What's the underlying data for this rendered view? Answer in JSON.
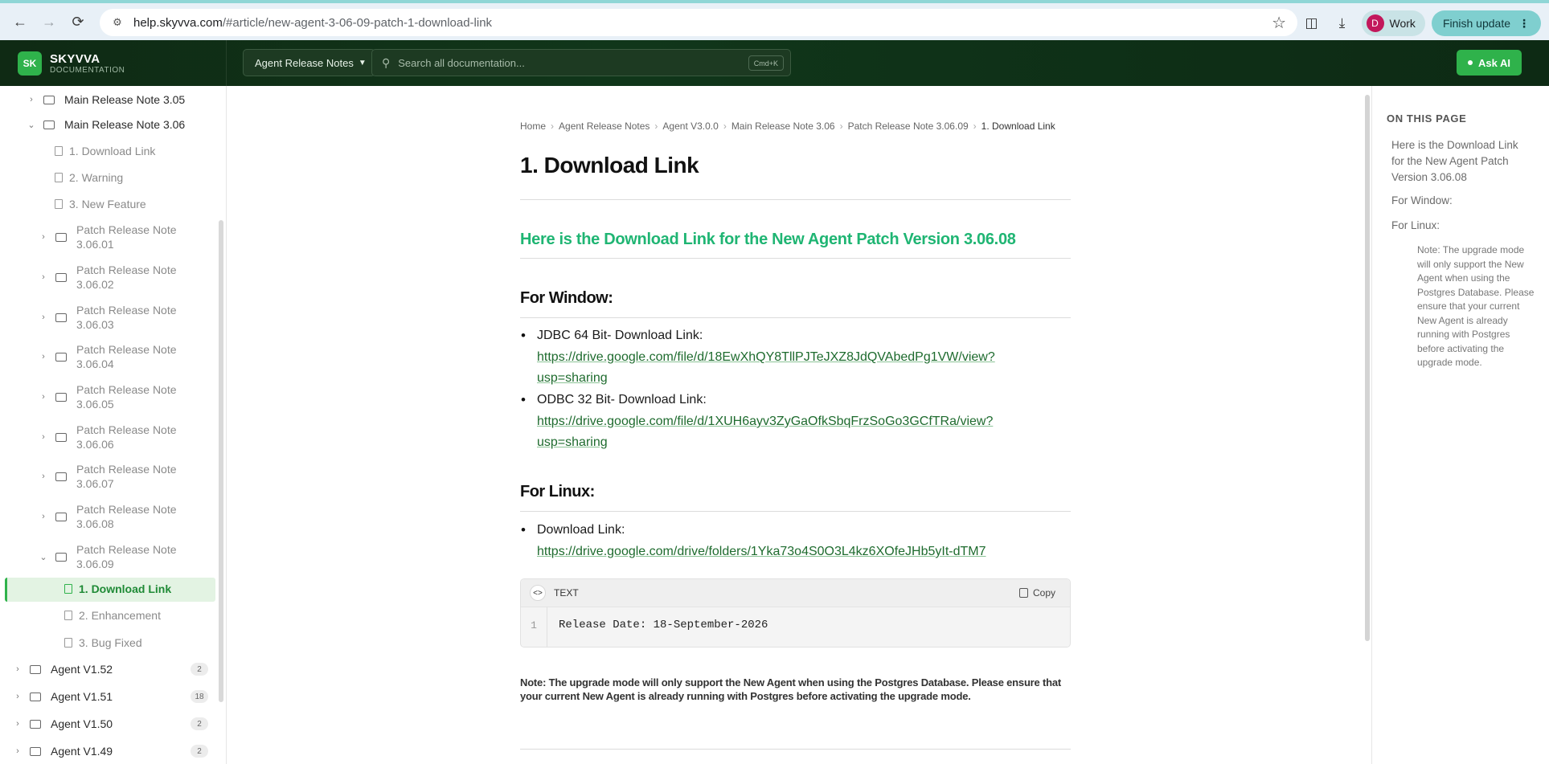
{
  "browser": {
    "url_host": "help.skyvva.com",
    "url_path": "/#article/new-agent-3-06-09-patch-1-download-link",
    "profile_initial": "D",
    "profile_label": "Work",
    "update_label": "Finish update"
  },
  "header": {
    "logo_text": "SK",
    "brand_name": "SKYVVA",
    "brand_sub": "DOCUMENTATION",
    "selector_label": "Agent Release Notes",
    "search_placeholder": "Search all documentation...",
    "search_shortcut": "Cmd+K",
    "ask_ai_label": "Ask AI"
  },
  "sidebar": {
    "items": [
      {
        "label": "Main Release Note 3.05"
      },
      {
        "label": "Main Release Note 3.06"
      },
      {
        "label": "1. Download Link"
      },
      {
        "label": "2. Warning"
      },
      {
        "label": "3. New Feature"
      },
      {
        "label": "Patch Release Note",
        "label2": "3.06.01"
      },
      {
        "label": "Patch Release Note",
        "label2": "3.06.02"
      },
      {
        "label": "Patch Release Note",
        "label2": "3.06.03"
      },
      {
        "label": "Patch Release Note",
        "label2": "3.06.04"
      },
      {
        "label": "Patch Release Note",
        "label2": "3.06.05"
      },
      {
        "label": "Patch Release Note",
        "label2": "3.06.06"
      },
      {
        "label": "Patch Release Note",
        "label2": "3.06.07"
      },
      {
        "label": "Patch Release Note",
        "label2": "3.06.08"
      },
      {
        "label": "Patch Release Note",
        "label2": "3.06.09"
      },
      {
        "label": "1. Download Link"
      },
      {
        "label": "2. Enhancement"
      },
      {
        "label": "3. Bug Fixed"
      },
      {
        "label": "Agent V1.52",
        "count": "2"
      },
      {
        "label": "Agent V1.51",
        "count": "18"
      },
      {
        "label": "Agent V1.50",
        "count": "2"
      },
      {
        "label": "Agent V1.49",
        "count": "2"
      }
    ]
  },
  "breadcrumb": {
    "items": [
      "Home",
      "Agent Release Notes",
      "Agent V3.0.0",
      "Main Release Note 3.06",
      "Patch Release Note 3.06.09"
    ],
    "current": "1. Download Link"
  },
  "article": {
    "title": "1. Download Link",
    "heading": "Here is the Download Link for the New Agent Patch Version 3.06.08",
    "window_heading": "For Window:",
    "jdbc_label": "JDBC 64 Bit- Download Link:",
    "jdbc_link_1": "https://drive.google.com/file/d/18EwXhQY8TllPJTeJXZ8JdQVAbedPg1VW/view?",
    "jdbc_link_2": "usp=sharing",
    "odbc_label": "ODBC 32 Bit- Download Link:",
    "odbc_link_1": "https://drive.google.com/file/d/1XUH6ayv3ZyGaOfkSbqFrzSoGo3GCfTRa/view?",
    "odbc_link_2": "usp=sharing",
    "linux_heading": "For Linux:",
    "linux_label": "Download Link:",
    "linux_link": "https://drive.google.com/drive/folders/1Yka73o4S0O3L4kz6XOfeJHb5yIt-dTM7",
    "code_lang": "TEXT",
    "copy_label": "Copy",
    "code_line_no": "1",
    "code_line": "Release Date: 18-September-2026",
    "note": "Note: The upgrade mode will only support the New Agent when using the Postgres Database. Please ensure that your current New Agent is already running with Postgres before activating the upgrade mode."
  },
  "toc": {
    "title": "ON THIS PAGE",
    "item1": "Here is the Download Link for the New Agent Patch Version 3.06.08",
    "item2": "For Window:",
    "item3": "For Linux:",
    "item4": "Note: The upgrade mode will only support the New Agent when using the Postgres Database. Please ensure that your current New Agent is already running with Postgres before activating the upgrade mode."
  }
}
